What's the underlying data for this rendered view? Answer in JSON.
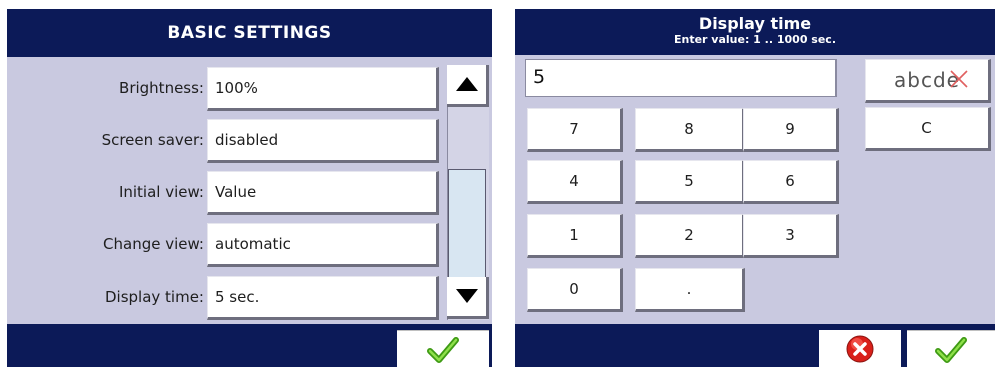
{
  "basic_settings": {
    "title": "BASIC SETTINGS",
    "rows": [
      {
        "label": "Brightness:",
        "value": "100%"
      },
      {
        "label": "Screen saver:",
        "value": "disabled"
      },
      {
        "label": "Initial view:",
        "value": "Value"
      },
      {
        "label": "Change view:",
        "value": "automatic"
      },
      {
        "label": "Display time:",
        "value": "5 sec."
      }
    ]
  },
  "display_time": {
    "title": "Display time",
    "subtitle": "Enter value: 1 .. 1000 sec.",
    "entry_value": "5",
    "mode_label": "abcde",
    "clear_label": "C",
    "keys": [
      "7",
      "8",
      "9",
      "4",
      "5",
      "6",
      "1",
      "2",
      "3",
      "0",
      "."
    ]
  },
  "icons": {
    "scroll_up": "triangle-up-icon",
    "scroll_down": "triangle-down-icon",
    "confirm": "checkmark-icon",
    "cancel": "red-x-circle-icon"
  },
  "colors": {
    "title_bar": "#0c1a58",
    "panel_bg": "#c9c9e0",
    "confirm_green": "#4caf1e",
    "cancel_red": "#d9201a"
  }
}
